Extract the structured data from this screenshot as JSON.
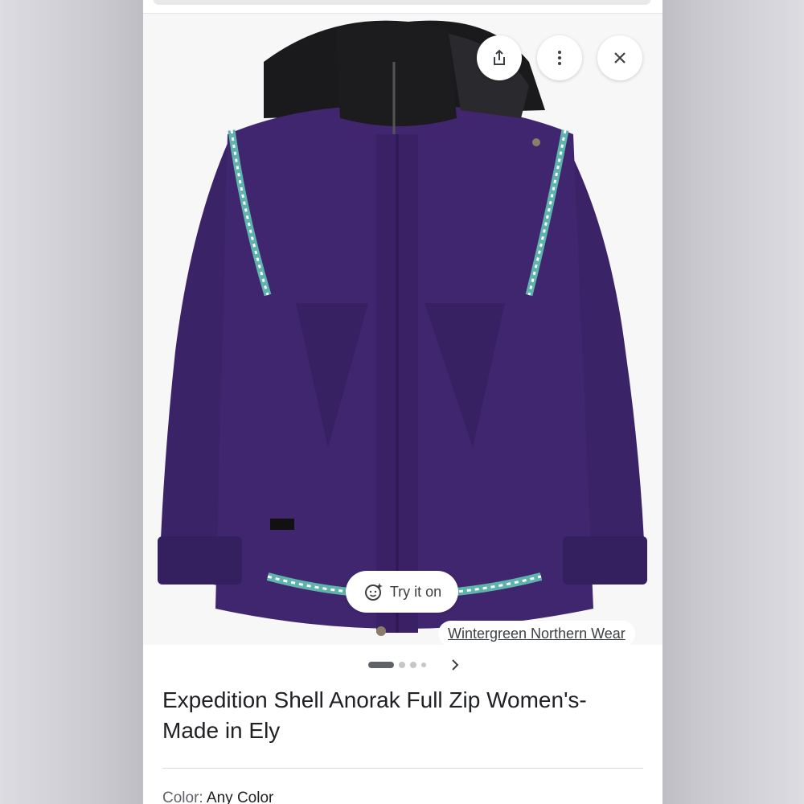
{
  "image": {
    "alt": "Expedition Shell Anorak Full Zip Women's- Made in Ely"
  },
  "actions": {
    "share_icon": "share-icon",
    "more_icon": "more-vert-icon",
    "close_icon": "close-icon"
  },
  "try_on": {
    "label": "Try it on",
    "icon": "sparkle-face-icon"
  },
  "source": {
    "name": "Wintergreen Northern Wear"
  },
  "pager": {
    "total_dots": 4,
    "active_index": 0,
    "next_icon": "chevron-right-icon"
  },
  "product": {
    "title": "Expedition Shell Anorak Full Zip Women's- Made in Ely",
    "color_label": "Color:",
    "color_value": "Any Color"
  },
  "colors": {
    "jacket": "#40266e",
    "jacket_shadow": "#2c1852",
    "fleece": "#1c1c1e",
    "trim": "#5fb3ad"
  }
}
